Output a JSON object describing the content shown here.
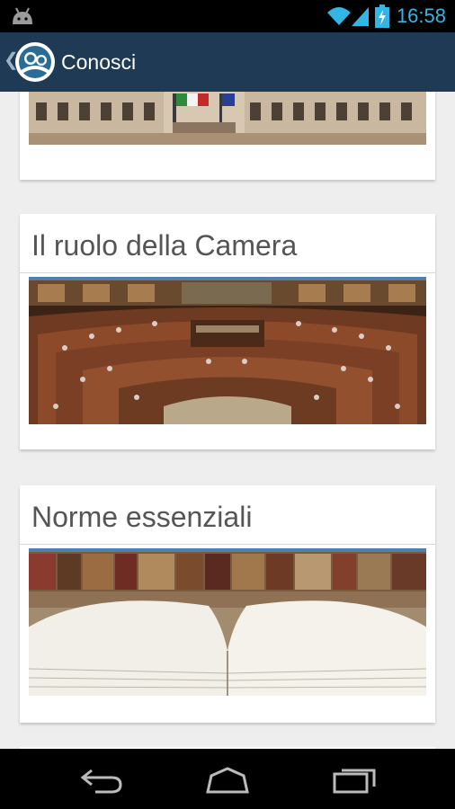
{
  "status_bar": {
    "time": "16:58",
    "icons": [
      "android-icon",
      "wifi-icon",
      "signal-icon",
      "battery-charging-icon"
    ],
    "accent_color": "#33b5e5"
  },
  "action_bar": {
    "title": "Conosci",
    "icons": [
      "back-chevron-icon",
      "app-logo-icon"
    ],
    "background_color": "#1f3a54"
  },
  "cards": [
    {
      "title": "",
      "image": "parliament-facade-image"
    },
    {
      "title": "Il ruolo della Camera",
      "image": "chamber-hemicycle-image"
    },
    {
      "title": "Norme essenziali",
      "image": "open-book-library-image"
    }
  ],
  "nav_bar": {
    "icons": [
      "back-nav-icon",
      "home-nav-icon",
      "recent-apps-icon"
    ]
  }
}
